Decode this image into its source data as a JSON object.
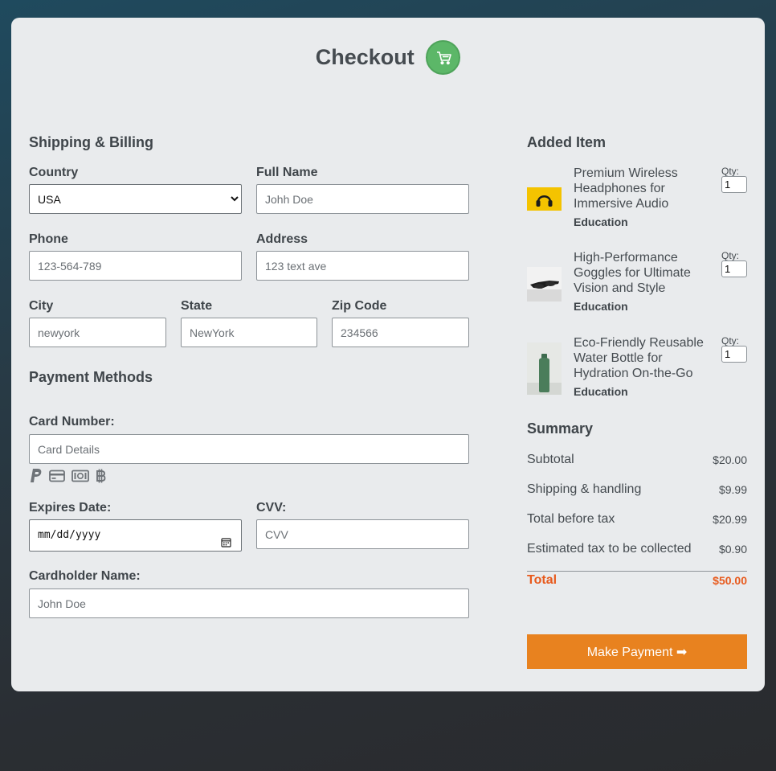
{
  "header": {
    "title": "Checkout",
    "cart_icon": "shopping-cart-icon"
  },
  "shipping": {
    "title": "Shipping & Billing",
    "country_label": "Country",
    "country_value": "USA",
    "fullname_label": "Full Name",
    "fullname_placeholder": "Johh Doe",
    "phone_label": "Phone",
    "phone_placeholder": "123-564-789",
    "address_label": "Address",
    "address_placeholder": "123 text ave",
    "city_label": "City",
    "city_placeholder": "newyork",
    "state_label": "State",
    "state_placeholder": "NewYork",
    "zip_label": "Zip Code",
    "zip_placeholder": "234566"
  },
  "payment": {
    "title": "Payment Methods",
    "card_label": "Card Number:",
    "card_placeholder": "Card Details",
    "icons": [
      "paypal-icon",
      "credit-card-icon",
      "money-bill-icon",
      "bitcoin-icon"
    ],
    "expires_label": "Expires Date:",
    "expires_placeholder": "mm/dd/yyyy",
    "cvv_label": "CVV:",
    "cvv_placeholder": "CVV",
    "holder_label": "Cardholder Name:",
    "holder_placeholder": "John Doe"
  },
  "items": {
    "title": "Added Item",
    "list": [
      {
        "name": "Premium Wireless Headphones for Immersive Audio",
        "category": "Education",
        "qty_label": "Qty:",
        "qty": "1"
      },
      {
        "name": "High-Performance Goggles for Ultimate Vision and Style",
        "category": "Education",
        "qty_label": "Qty:",
        "qty": "1"
      },
      {
        "name": "Eco-Friendly Reusable Water Bottle for Hydration On-the-Go",
        "category": "Education",
        "qty_label": "Qty:",
        "qty": "1"
      }
    ]
  },
  "summary": {
    "title": "Summary",
    "subtotal_label": "Subtotal",
    "subtotal": "$20.00",
    "shipping_label": "Shipping & handling",
    "shipping": "$9.99",
    "before_tax_label": "Total before tax",
    "before_tax": "$20.99",
    "tax_label": "Estimated tax to be collected",
    "tax": "$0.90",
    "total_label": "Total",
    "total": "$50.00"
  },
  "button": {
    "label": "Make Payment ➡",
    "color": "#e8821f"
  },
  "colors": {
    "accent_green": "#5cb768",
    "total_red": "#e85a1d"
  }
}
